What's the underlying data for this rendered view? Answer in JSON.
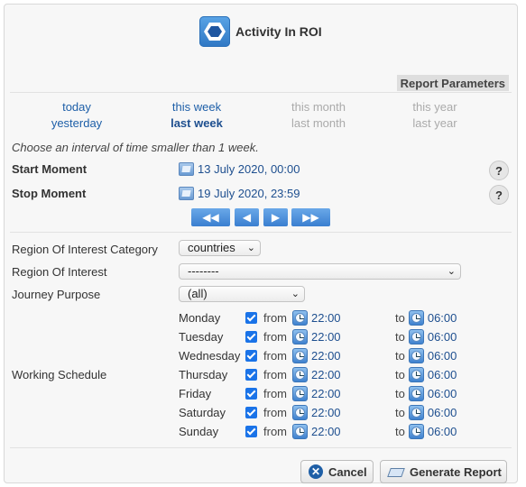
{
  "window": {
    "title": "Activity In ROI"
  },
  "section": {
    "tab_label": "Report Parameters"
  },
  "periods": {
    "row1": [
      "today",
      "this week",
      "this month",
      "this year"
    ],
    "row2": [
      "yesterday",
      "last week",
      "last month",
      "last year"
    ]
  },
  "hint": "Choose an interval of time smaller than 1 week.",
  "start": {
    "label": "Start Moment",
    "value": "13 July 2020, 00:00",
    "help": "?"
  },
  "stop": {
    "label": "Stop Moment",
    "value": "19 July 2020, 23:59",
    "help": "?"
  },
  "nav": {
    "first": "◀◀",
    "prev": "◀",
    "next": "▶",
    "last": "▶▶"
  },
  "fields": {
    "roi_category": {
      "label": "Region Of Interest Category",
      "value": "countries"
    },
    "roi": {
      "label": "Region Of Interest",
      "value": "--------"
    },
    "journey": {
      "label": "Journey Purpose",
      "value": "(all)"
    }
  },
  "schedule": {
    "label": "Working Schedule",
    "from_label": "from",
    "to_label": "to",
    "days": [
      {
        "day": "Monday",
        "from": "22:00",
        "to": "06:00"
      },
      {
        "day": "Tuesday",
        "from": "22:00",
        "to": "06:00"
      },
      {
        "day": "Wednesday",
        "from": "22:00",
        "to": "06:00"
      },
      {
        "day": "Thursday",
        "from": "22:00",
        "to": "06:00"
      },
      {
        "day": "Friday",
        "from": "22:00",
        "to": "06:00"
      },
      {
        "day": "Saturday",
        "from": "22:00",
        "to": "06:00"
      },
      {
        "day": "Sunday",
        "from": "22:00",
        "to": "06:00"
      }
    ]
  },
  "buttons": {
    "cancel": "Cancel",
    "generate": "Generate Report"
  }
}
